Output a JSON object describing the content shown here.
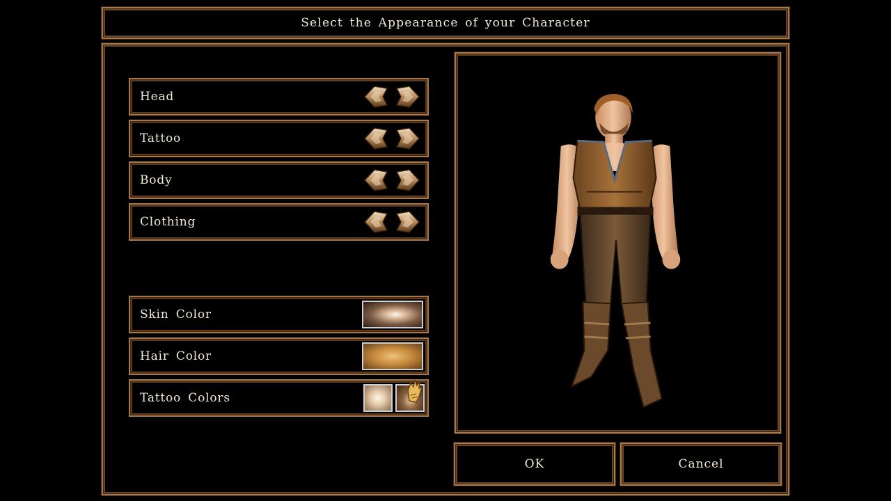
{
  "header": {
    "title": "Select the Appearance of your Character"
  },
  "appearance_options": [
    {
      "label": "Head"
    },
    {
      "label": "Tattoo"
    },
    {
      "label": "Body"
    },
    {
      "label": "Clothing"
    }
  ],
  "color_options": [
    {
      "label": "Skin Color",
      "swatch": "#d9b89a"
    },
    {
      "label": "Hair Color",
      "swatch": "#c88c3e"
    },
    {
      "label": "Tattoo Colors",
      "swatches": [
        "#e8cfb0",
        "#8a6440"
      ]
    }
  ],
  "icons": {
    "previous": "left-arrow-icon",
    "next": "right-arrow-icon",
    "cursor": "gauntlet-cursor-icon"
  },
  "buttons": {
    "ok": "OK",
    "cancel": "Cancel"
  },
  "theme": {
    "border": "#a8794a",
    "text": "#f2ead8",
    "background": "#000000"
  }
}
